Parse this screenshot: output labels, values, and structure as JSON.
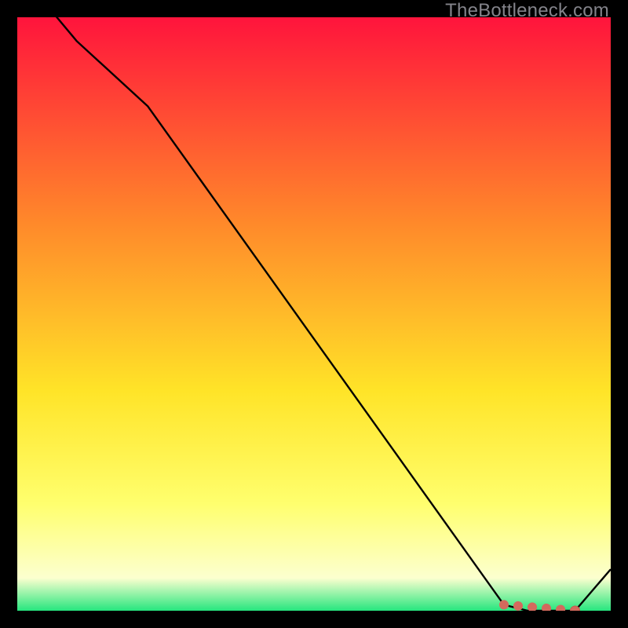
{
  "watermark": "TheBottleneck.com",
  "colors": {
    "gradient_top": "#ff143c",
    "gradient_mid_upper": "#ff8a2a",
    "gradient_mid": "#ffe428",
    "gradient_mid_lower": "#ffff6e",
    "gradient_low": "#fcffcf",
    "gradient_bottom": "#26e67e",
    "curve": "#000000",
    "marker_fill": "#d36a5d",
    "marker_stroke": "#c75a4e"
  },
  "chart_data": {
    "type": "line",
    "x": [
      0,
      10,
      22,
      82,
      86,
      88,
      90,
      92,
      94,
      100
    ],
    "values": [
      108,
      96,
      85,
      1,
      0,
      0,
      0,
      0,
      0,
      7
    ],
    "xlim": [
      0,
      100
    ],
    "ylim": [
      0,
      100
    ],
    "xlabel": "",
    "ylabel": "",
    "title": "",
    "grid": false,
    "legend": false,
    "markers": {
      "segment_band": {
        "x0": 82,
        "y0": 1,
        "x1": 94,
        "y1": 0
      },
      "end_point": {
        "x": 94,
        "y": 0
      }
    }
  }
}
